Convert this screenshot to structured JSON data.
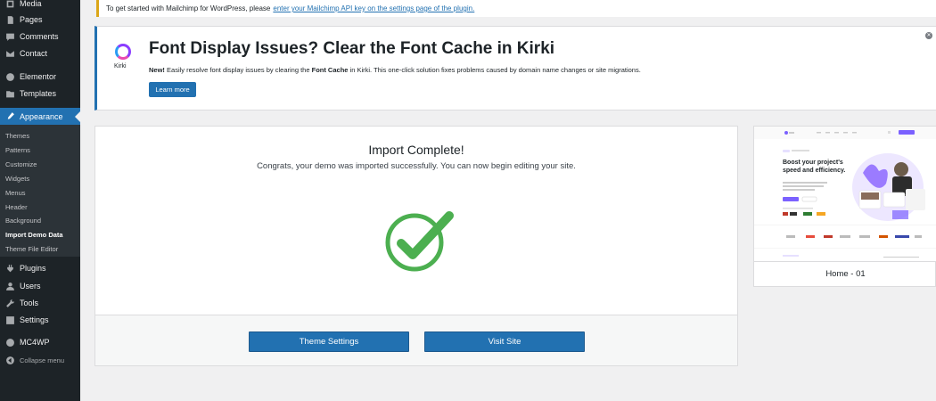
{
  "sidebar": {
    "items": [
      {
        "label": "Media",
        "icon": "media-icon"
      },
      {
        "label": "Pages",
        "icon": "pages-icon"
      },
      {
        "label": "Comments",
        "icon": "comments-icon"
      },
      {
        "label": "Contact",
        "icon": "contact-icon"
      },
      {
        "label": "Elementor",
        "icon": "elementor-icon"
      },
      {
        "label": "Templates",
        "icon": "templates-icon"
      },
      {
        "label": "Appearance",
        "icon": "appearance-icon"
      },
      {
        "label": "Plugins",
        "icon": "plugins-icon"
      },
      {
        "label": "Users",
        "icon": "users-icon"
      },
      {
        "label": "Tools",
        "icon": "tools-icon"
      },
      {
        "label": "Settings",
        "icon": "settings-icon"
      },
      {
        "label": "MC4WP",
        "icon": "mc4wp-icon"
      },
      {
        "label": "Collapse menu",
        "icon": "collapse-icon"
      }
    ],
    "submenu": [
      "Themes",
      "Patterns",
      "Customize",
      "Widgets",
      "Menus",
      "Header",
      "Background",
      "Import Demo Data",
      "Theme File Editor"
    ],
    "active_item": "Appearance",
    "current_subitem": "Import Demo Data"
  },
  "notice": {
    "text": "To get started with Mailchimp for WordPress, please",
    "link": "enter your Mailchimp API key on the settings page of the plugin."
  },
  "kirki": {
    "logo_text": "Kirki",
    "title": "Font Display Issues? Clear the Font Cache in Kirki",
    "new_label": "New!",
    "desc_1": "Easily resolve font display issues by clearing the",
    "desc_bold": "Font Cache",
    "desc_2": "in Kirki. This one-click solution fixes problems caused by domain name changes or site migrations.",
    "button": "Learn more"
  },
  "import": {
    "title": "Import Complete!",
    "subtitle": "Congrats, your demo was imported successfully. You can now begin editing your site.",
    "theme_settings_button": "Theme Settings",
    "visit_site_button": "Visit Site"
  },
  "demo": {
    "label": "Home - 01",
    "headline": "Boost your project's speed and efficiency."
  },
  "colors": {
    "sidebar_bg": "#1d2327",
    "accent": "#2271b1",
    "success": "#4caf50",
    "demo_accent": "#7b61ff"
  }
}
